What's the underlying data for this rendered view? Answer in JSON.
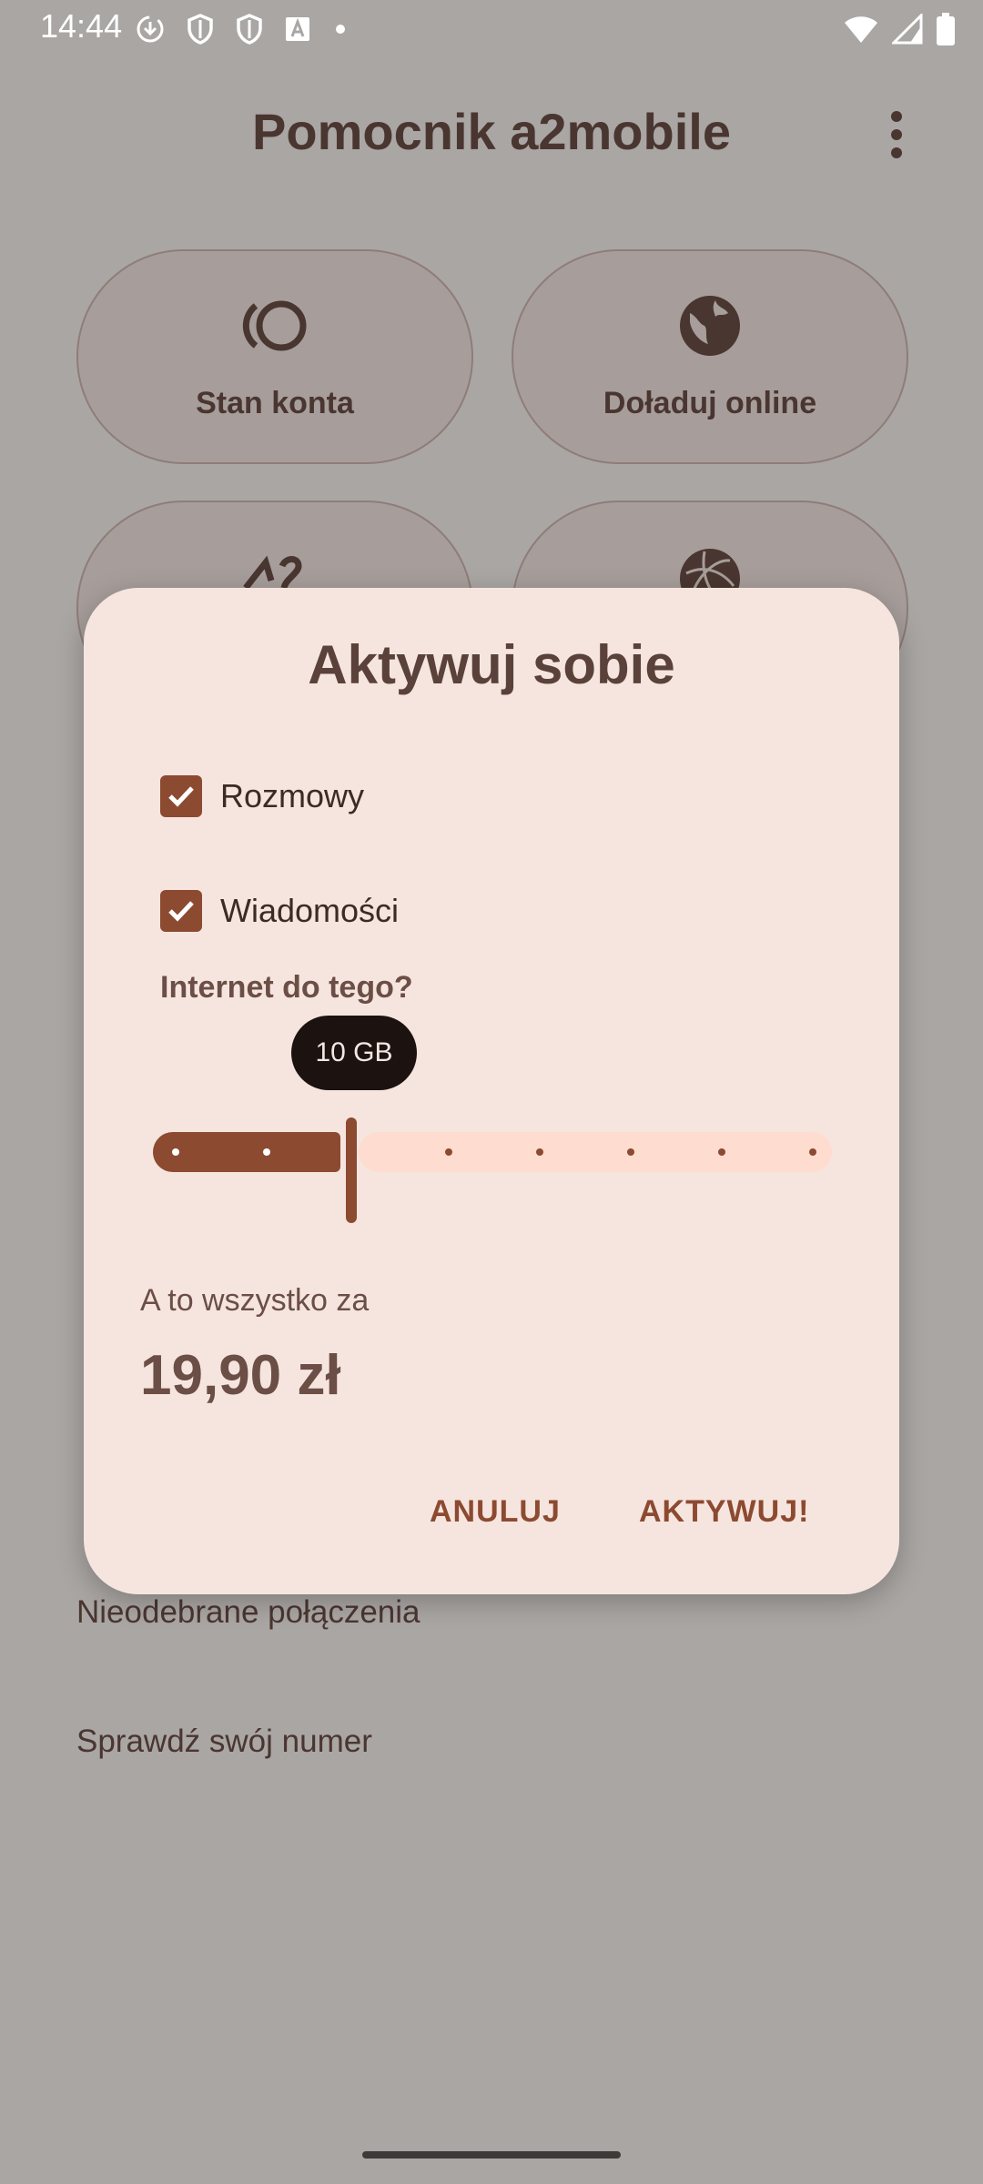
{
  "status_bar": {
    "time": "14:44"
  },
  "app_bar": {
    "title": "Pomocnik a2mobile"
  },
  "tiles": [
    {
      "label": "Stan konta",
      "icon": "refresh-ring-icon"
    },
    {
      "label": "Doładuj online",
      "icon": "globe-icon"
    },
    {
      "label": "",
      "icon": "a2-logo-icon"
    },
    {
      "label": "",
      "icon": "yarn-ball-icon"
    }
  ],
  "background_list": [
    {
      "label": "Nieodebrane połączenia"
    },
    {
      "label": "Sprawdź swój numer"
    }
  ],
  "dialog": {
    "title": "Aktywuj sobie",
    "options": [
      {
        "label": "Rozmowy",
        "checked": true
      },
      {
        "label": "Wiadomości",
        "checked": true
      }
    ],
    "internet_label": "Internet do tego?",
    "slider": {
      "value_label": "10 GB",
      "stops": 8,
      "selected_index": 2
    },
    "price_label": "A to wszystko za",
    "price": "19,90 zł",
    "cancel_label": "ANULUJ",
    "confirm_label": "AKTYWUJ!"
  },
  "colors": {
    "accent": "#8c4a31",
    "dialog_bg": "#f6e5df",
    "scrim_bg": "#aaa6a4",
    "track_inactive": "#ffdcd0"
  }
}
